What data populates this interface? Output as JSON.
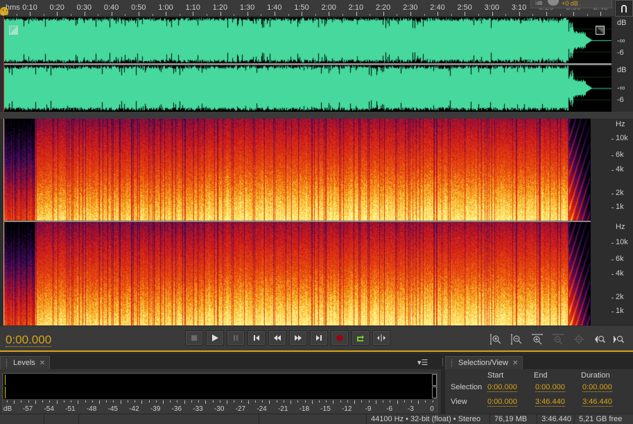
{
  "ruler": {
    "unit_label": "hms",
    "labels": [
      "0:10",
      "0:20",
      "0:30",
      "0:40",
      "0:50",
      "1:00",
      "1:10",
      "1:20",
      "1:30",
      "1:40",
      "1:50",
      "2:00",
      "2:10",
      "2:20",
      "2:30",
      "2:40",
      "2:50",
      "3:00",
      "3:10",
      "3:20",
      "3:30",
      "3:40"
    ]
  },
  "hud": {
    "volume_value": "+0 dB"
  },
  "waveform": {
    "channel_1": {
      "scale_title": "dB",
      "scale_labels": [
        "-∞",
        "-6"
      ]
    },
    "channel_2": {
      "scale_title": "dB",
      "scale_labels": [
        "-∞",
        "-6"
      ]
    },
    "color": "#46d89c"
  },
  "spectrogram": {
    "channel_1": {
      "scale_title": "Hz",
      "scale_labels": [
        "10k",
        "6k",
        "4k",
        "2k",
        "1k"
      ]
    },
    "channel_2": {
      "scale_title": "Hz",
      "scale_labels": [
        "10k",
        "6k",
        "4k",
        "2k",
        "1k"
      ]
    }
  },
  "transport": {
    "current_time": "0:00.000",
    "buttons": [
      {
        "name": "stop",
        "icon": "stop-icon",
        "enabled": false
      },
      {
        "name": "play",
        "icon": "play-icon",
        "enabled": true
      },
      {
        "name": "pause",
        "icon": "pause-icon",
        "enabled": false
      },
      {
        "name": "move-to-previous",
        "icon": "skip-back-icon",
        "enabled": true
      },
      {
        "name": "rewind",
        "icon": "rewind-icon",
        "enabled": true
      },
      {
        "name": "fast-forward",
        "icon": "fast-forward-icon",
        "enabled": true
      },
      {
        "name": "move-to-next",
        "icon": "skip-forward-icon",
        "enabled": true
      },
      {
        "name": "record",
        "icon": "record-icon",
        "enabled": true
      },
      {
        "name": "loop-playback",
        "icon": "loop-icon",
        "enabled": true
      },
      {
        "name": "skip-selection",
        "icon": "skip-selection-icon",
        "enabled": true
      }
    ],
    "zoom_buttons": [
      {
        "name": "zoom-in-amplitude",
        "enabled": true
      },
      {
        "name": "zoom-out-amplitude",
        "enabled": true
      },
      {
        "name": "zoom-in-time",
        "enabled": true
      },
      {
        "name": "zoom-out-full",
        "enabled": false
      },
      {
        "name": "zoom-to-selection",
        "enabled": false
      },
      {
        "name": "zoom-in-at-in-point",
        "enabled": true
      },
      {
        "name": "zoom-in-at-out-point",
        "enabled": true
      }
    ]
  },
  "levels_panel": {
    "title": "Levels",
    "scale_unit": "dB",
    "scale_labels": [
      "-57",
      "-54",
      "-51",
      "-48",
      "-45",
      "-42",
      "-39",
      "-36",
      "-33",
      "-30",
      "-27",
      "-24",
      "-21",
      "-18",
      "-15",
      "-12",
      "-9",
      "-6",
      "-3",
      "0"
    ]
  },
  "selection_view_panel": {
    "title": "Selection/View",
    "columns": [
      "Start",
      "End",
      "Duration"
    ],
    "rows": [
      {
        "label": "Selection",
        "start": "0:00.000",
        "end": "0:00.000",
        "duration": "0:00.000"
      },
      {
        "label": "View",
        "start": "0:00.000",
        "end": "3:46.440",
        "duration": "3:46.440"
      }
    ]
  },
  "status_bar": {
    "format": "44100 Hz • 32-bit (float) • Stereo",
    "file_size": "76,19 MB",
    "duration": "3:46.440",
    "free_space": "5,21 GB free"
  },
  "colors": {
    "accent": "#d8a418",
    "waveform": "#46d89c",
    "record": "#a00010",
    "loop": "#7ccc2a"
  }
}
